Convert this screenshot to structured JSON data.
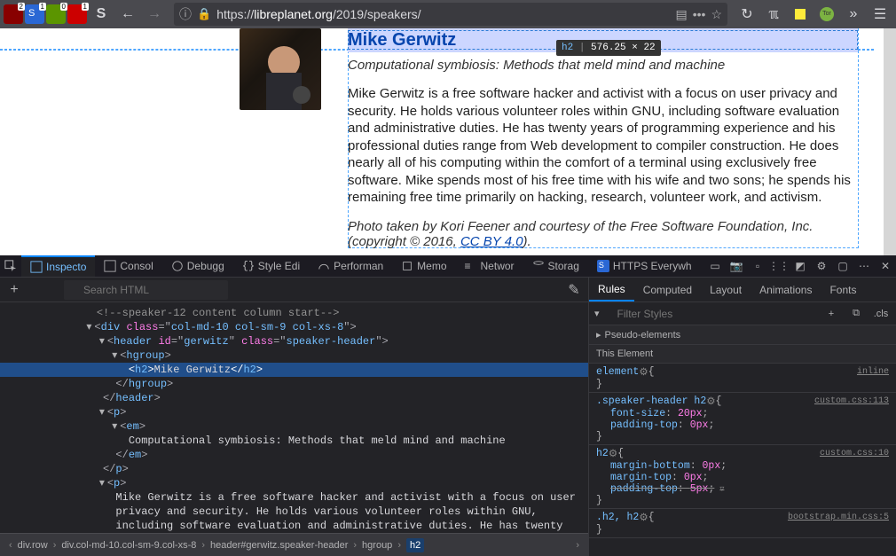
{
  "toolbar": {
    "ext_badges": [
      {
        "bg": "#a00",
        "fg": "#fff",
        "glyph": "u",
        "num": "2"
      },
      {
        "bg": "#2a67d4",
        "fg": "#fff",
        "glyph": "S",
        "num": "1"
      },
      {
        "bg": "#5b9500",
        "fg": "#fff",
        "glyph": "✓",
        "num": "0"
      },
      {
        "bg": "#c00",
        "fg": "#fff",
        "glyph": "■",
        "num": "1"
      }
    ],
    "url_proto": "https://",
    "url_domain": "libreplanet.org",
    "url_path": "/2019/speakers/"
  },
  "tooltip": {
    "tag": "h2",
    "dims": "576.25 × 22"
  },
  "speaker": {
    "name": "Mike Gerwitz",
    "subtitle": "Computational symbiosis: Methods that meld mind and machine",
    "bio": "Mike Gerwitz is a free software hacker and activist with a focus on user privacy and security. He holds various volunteer roles within GNU, including software evaluation and administrative duties. He has twenty years of programming experience and his professional duties range from Web development to compiler construction. He does nearly all of his computing within the comfort of a terminal using exclusively free software. Mike spends most of his free time with his wife and two sons; he spends his remaining free time primarily on hacking, research, volunteer work, and activism.",
    "credit_pre": "Photo taken by Kori Feener and courtesy of the Free Software Foundation, Inc. (copyright © 2016, ",
    "credit_link": "CC BY 4.0",
    "credit_post": ")."
  },
  "devtools_tabs": [
    "Inspector",
    "Console",
    "Debugger",
    "Style Editor",
    "Performance",
    "Memory",
    "Network",
    "Storage",
    "HTTPS Everywhere"
  ],
  "devtools_tabs_short": [
    "Inspecto",
    "Consol",
    "Debugg",
    "Style Edi",
    "Performan",
    "Memo",
    "Networ",
    "Storag",
    "HTTPS Everywh"
  ],
  "search_placeholder": "Search HTML",
  "breadcrumb": [
    "div.row",
    "div.col-md-10.col-sm-9.col-xs-8",
    "header#gerwitz.speaker-header",
    "hgroup",
    "h2"
  ],
  "dom": {
    "comment1": "<!--speaker-12 content column start-->",
    "div_classes": "col-md-10 col-sm-9 col-xs-8",
    "header_id": "gerwitz",
    "header_class": "speaker-header",
    "h2_text": "Mike Gerwitz",
    "em_text": "Computational symbiosis: Methods that meld mind and machine",
    "bio_text": "Mike Gerwitz is a free software hacker and activist with a focus on user privacy and security. He holds various volunteer roles within GNU, including software evaluation and administrative duties. He has twenty"
  },
  "rules_tabs": [
    "Rules",
    "Computed",
    "Layout",
    "Animations",
    "Fonts"
  ],
  "filter_placeholder": "Filter Styles",
  "pseudo_header": "Pseudo-elements",
  "this_element": "This Element",
  "css_rules": [
    {
      "selector": "element",
      "icon": true,
      "src": "inline",
      "decls": []
    },
    {
      "selector": ".speaker-header h2",
      "icon": true,
      "src": "custom.css:113",
      "decls": [
        {
          "pn": "font-size",
          "pv": "20px"
        },
        {
          "pn": "padding-top",
          "pv": "0px"
        }
      ]
    },
    {
      "selector": "h2",
      "icon": true,
      "src": "custom.css:10",
      "decls": [
        {
          "pn": "margin-bottom",
          "pv": "0px"
        },
        {
          "pn": "margin-top",
          "pv": "0px"
        },
        {
          "pn": "padding-top",
          "pv": "5px",
          "strike": true
        }
      ]
    },
    {
      "selector": ".h2, h2",
      "icon": true,
      "src": "bootstrap.min.css:5",
      "decls": []
    }
  ]
}
